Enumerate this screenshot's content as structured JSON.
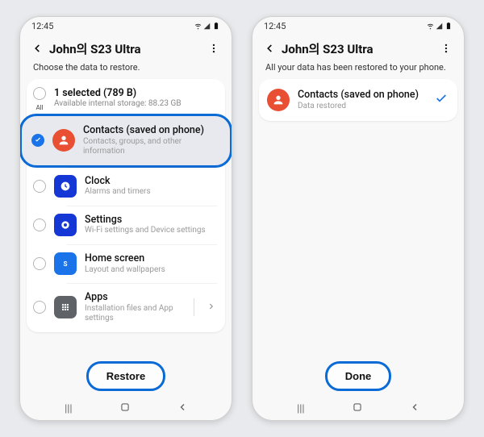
{
  "status": {
    "time": "12:45"
  },
  "left": {
    "title": "John의 S23 Ultra",
    "subhead": "Choose the data to restore.",
    "summary": {
      "t1": "1 selected (789 B)",
      "t2": "Available internal storage: 88.23 GB"
    },
    "items": [
      {
        "t1": "Contacts (saved on phone)",
        "t2": "Contacts, groups, and other information"
      },
      {
        "t1": "Clock",
        "t2": "Alarms and timers"
      },
      {
        "t1": "Settings",
        "t2": "Wi-Fi settings and Device settings"
      },
      {
        "t1": "Home screen",
        "t2": "Layout and wallpapers"
      },
      {
        "t1": "Apps",
        "t2": "Installation files and App settings"
      }
    ],
    "button": "Restore"
  },
  "right": {
    "title": "John의 S23 Ultra",
    "subhead": "All your data has been restored to your phone.",
    "result": {
      "t1": "Contacts (saved on phone)",
      "t2": "Data restored"
    },
    "button": "Done"
  },
  "colors": {
    "contacts": "#e84f33",
    "clock": "#1537d6",
    "settings": "#1537d6",
    "home": "#1a73e8",
    "apps": "#5f6368",
    "accent": "#0a6ad6"
  }
}
